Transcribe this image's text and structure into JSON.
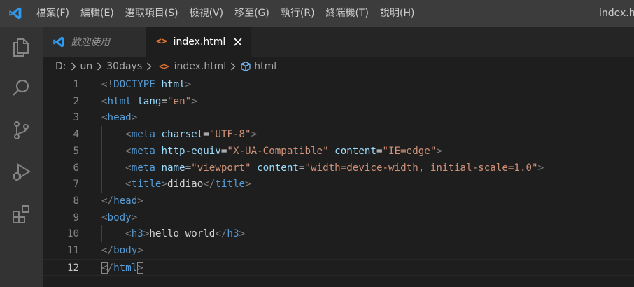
{
  "window_title": "index.ht",
  "menu": [
    "檔案(F)",
    "編輯(E)",
    "選取項目(S)",
    "檢視(V)",
    "移至(G)",
    "執行(R)",
    "終端機(T)",
    "說明(H)"
  ],
  "activity_icons": [
    "files-icon",
    "search-icon",
    "source-control-icon",
    "run-debug-icon",
    "extensions-icon"
  ],
  "tabs": [
    {
      "label": "歡迎使用",
      "active": false
    },
    {
      "label": "index.html",
      "active": true
    }
  ],
  "breadcrumb": [
    "D:",
    "un",
    "30days",
    "index.html",
    "html"
  ],
  "colors": {
    "accent": "#007acc",
    "tag": "#569cd6",
    "attr": "#9cdcfe",
    "string": "#ce9178",
    "punct": "#808080",
    "text": "#d4d4d4",
    "html_icon": "#e37933"
  },
  "code_lines": [
    {
      "n": "1",
      "tokens": [
        [
          "p",
          "<!"
        ],
        [
          "t",
          "DOCTYPE"
        ],
        [
          "x",
          " "
        ],
        [
          "a",
          "html"
        ],
        [
          "p",
          ">"
        ]
      ]
    },
    {
      "n": "2",
      "tokens": [
        [
          "p",
          "<"
        ],
        [
          "t",
          "html"
        ],
        [
          "x",
          " "
        ],
        [
          "a",
          "lang"
        ],
        [
          "x",
          "="
        ],
        [
          "s",
          "\"en\""
        ],
        [
          "p",
          ">"
        ]
      ]
    },
    {
      "n": "3",
      "tokens": [
        [
          "p",
          "<"
        ],
        [
          "t",
          "head"
        ],
        [
          "p",
          ">"
        ]
      ]
    },
    {
      "n": "4",
      "indent": true,
      "tokens": [
        [
          "p",
          "<"
        ],
        [
          "t",
          "meta"
        ],
        [
          "x",
          " "
        ],
        [
          "a",
          "charset"
        ],
        [
          "x",
          "="
        ],
        [
          "s",
          "\"UTF-8\""
        ],
        [
          "p",
          ">"
        ]
      ]
    },
    {
      "n": "5",
      "indent": true,
      "tokens": [
        [
          "p",
          "<"
        ],
        [
          "t",
          "meta"
        ],
        [
          "x",
          " "
        ],
        [
          "a",
          "http-equiv"
        ],
        [
          "x",
          "="
        ],
        [
          "s",
          "\"X-UA-Compatible\""
        ],
        [
          "x",
          " "
        ],
        [
          "a",
          "content"
        ],
        [
          "x",
          "="
        ],
        [
          "s",
          "\"IE=edge\""
        ],
        [
          "p",
          ">"
        ]
      ]
    },
    {
      "n": "6",
      "indent": true,
      "tokens": [
        [
          "p",
          "<"
        ],
        [
          "t",
          "meta"
        ],
        [
          "x",
          " "
        ],
        [
          "a",
          "name"
        ],
        [
          "x",
          "="
        ],
        [
          "s",
          "\"viewport\""
        ],
        [
          "x",
          " "
        ],
        [
          "a",
          "content"
        ],
        [
          "x",
          "="
        ],
        [
          "s",
          "\"width=device-width, initial-scale=1.0\""
        ],
        [
          "p",
          ">"
        ]
      ]
    },
    {
      "n": "7",
      "indent": true,
      "tokens": [
        [
          "p",
          "<"
        ],
        [
          "t",
          "title"
        ],
        [
          "p",
          ">"
        ],
        [
          "x",
          "didiao"
        ],
        [
          "p",
          "</"
        ],
        [
          "t",
          "title"
        ],
        [
          "p",
          ">"
        ]
      ]
    },
    {
      "n": "8",
      "tokens": [
        [
          "p",
          "</"
        ],
        [
          "t",
          "head"
        ],
        [
          "p",
          ">"
        ]
      ]
    },
    {
      "n": "9",
      "tokens": [
        [
          "p",
          "<"
        ],
        [
          "t",
          "body"
        ],
        [
          "p",
          ">"
        ]
      ]
    },
    {
      "n": "10",
      "indent": true,
      "tokens": [
        [
          "p",
          "<"
        ],
        [
          "t",
          "h3"
        ],
        [
          "p",
          ">"
        ],
        [
          "x",
          "hello world"
        ],
        [
          "p",
          "</"
        ],
        [
          "t",
          "h3"
        ],
        [
          "p",
          ">"
        ]
      ]
    },
    {
      "n": "11",
      "tokens": [
        [
          "p",
          "</"
        ],
        [
          "t",
          "body"
        ],
        [
          "p",
          ">"
        ]
      ]
    },
    {
      "n": "12",
      "current": true,
      "tokens": [
        [
          "pb",
          "<"
        ],
        [
          "p",
          "/"
        ],
        [
          "t",
          "html"
        ],
        [
          "pb",
          ">"
        ]
      ]
    }
  ]
}
